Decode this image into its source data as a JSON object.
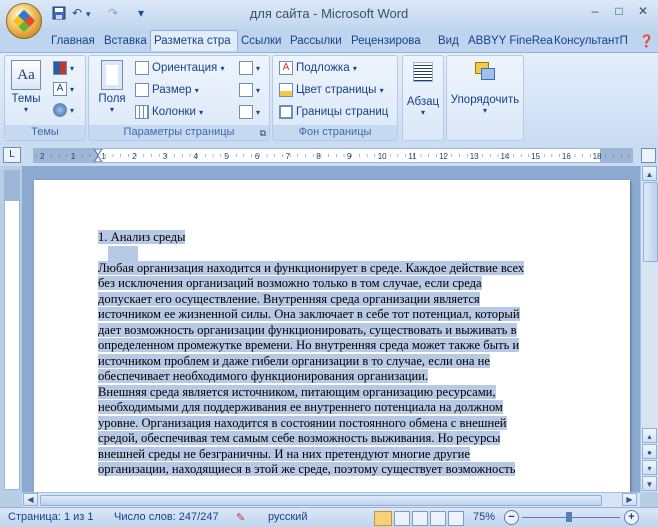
{
  "window": {
    "title": "для сайта - Microsoft Word",
    "controls": {
      "minimize": "–",
      "maximize": "□",
      "close": "✕"
    },
    "qat": {
      "save": "save-icon",
      "undo": "↶",
      "redo": "↷",
      "customize": "▾"
    }
  },
  "tabs": [
    "Главная",
    "Вставка",
    "Разметка стра",
    "Ссылки",
    "Рассылки",
    "Рецензирова",
    "Вид",
    "ABBYY FineRea",
    "КонсультантП"
  ],
  "ribbon": {
    "themes": {
      "big_button": "Темы",
      "group_label": "Темы"
    },
    "page_setup": {
      "fields_button": "Поля",
      "orientation": "Ориентация",
      "size": "Размер",
      "columns": "Колонки",
      "group_label": "Параметры страницы"
    },
    "page_background": {
      "watermark": "Подложка",
      "page_color": "Цвет страницы",
      "page_borders": "Границы страниц",
      "group_label": "Фон страницы"
    },
    "paragraph": {
      "label": "Абзац"
    },
    "arrange": {
      "label": "Упорядочить"
    }
  },
  "ruler": {
    "corner": "L",
    "labels": [
      "2",
      "1",
      "1",
      "2",
      "3",
      "4",
      "5",
      "6",
      "7",
      "8",
      "9",
      "10",
      "11",
      "12",
      "13",
      "14",
      "15",
      "16",
      "18"
    ]
  },
  "document": {
    "heading": "1. Анализ среды",
    "lines": [
      "Любая организация находится и функционирует в среде. Каждое действие всех",
      "без исключения организаций возможно только в том случае, если среда",
      "допускает его осуществление. Внутренняя среда организации является",
      "источником  ее жизненной силы. Она заключает   в себе тот потенциал, который",
      "дает возможность организации функционировать, существовать и выживать в",
      "определенном промежутке времени. Но внутренняя среда может также быть и",
      "источником проблем  и даже гибели организации в то случае, если она не",
      "обеспечивает необходимого функционирования  организации.",
      "Внешняя  среда является  источником, питающим организацию ресурсами,",
      "необходимыми для поддерживания ее внутреннего потенциала на должном",
      "уровне. Организация находится в состоянии постоянного обмена с внешней",
      "средой, обеспечивая тем самым себе  возможность выживания. Но ресурсы",
      "внешней среды не безграничны. И на них претендуют многие другие",
      "организации, находящиеся в этой же среде, поэтому существует возможность"
    ]
  },
  "statusbar": {
    "page": "Страница: 1 из 1",
    "words": "Число слов: 247/247",
    "language": "русский",
    "zoom": "75%"
  }
}
